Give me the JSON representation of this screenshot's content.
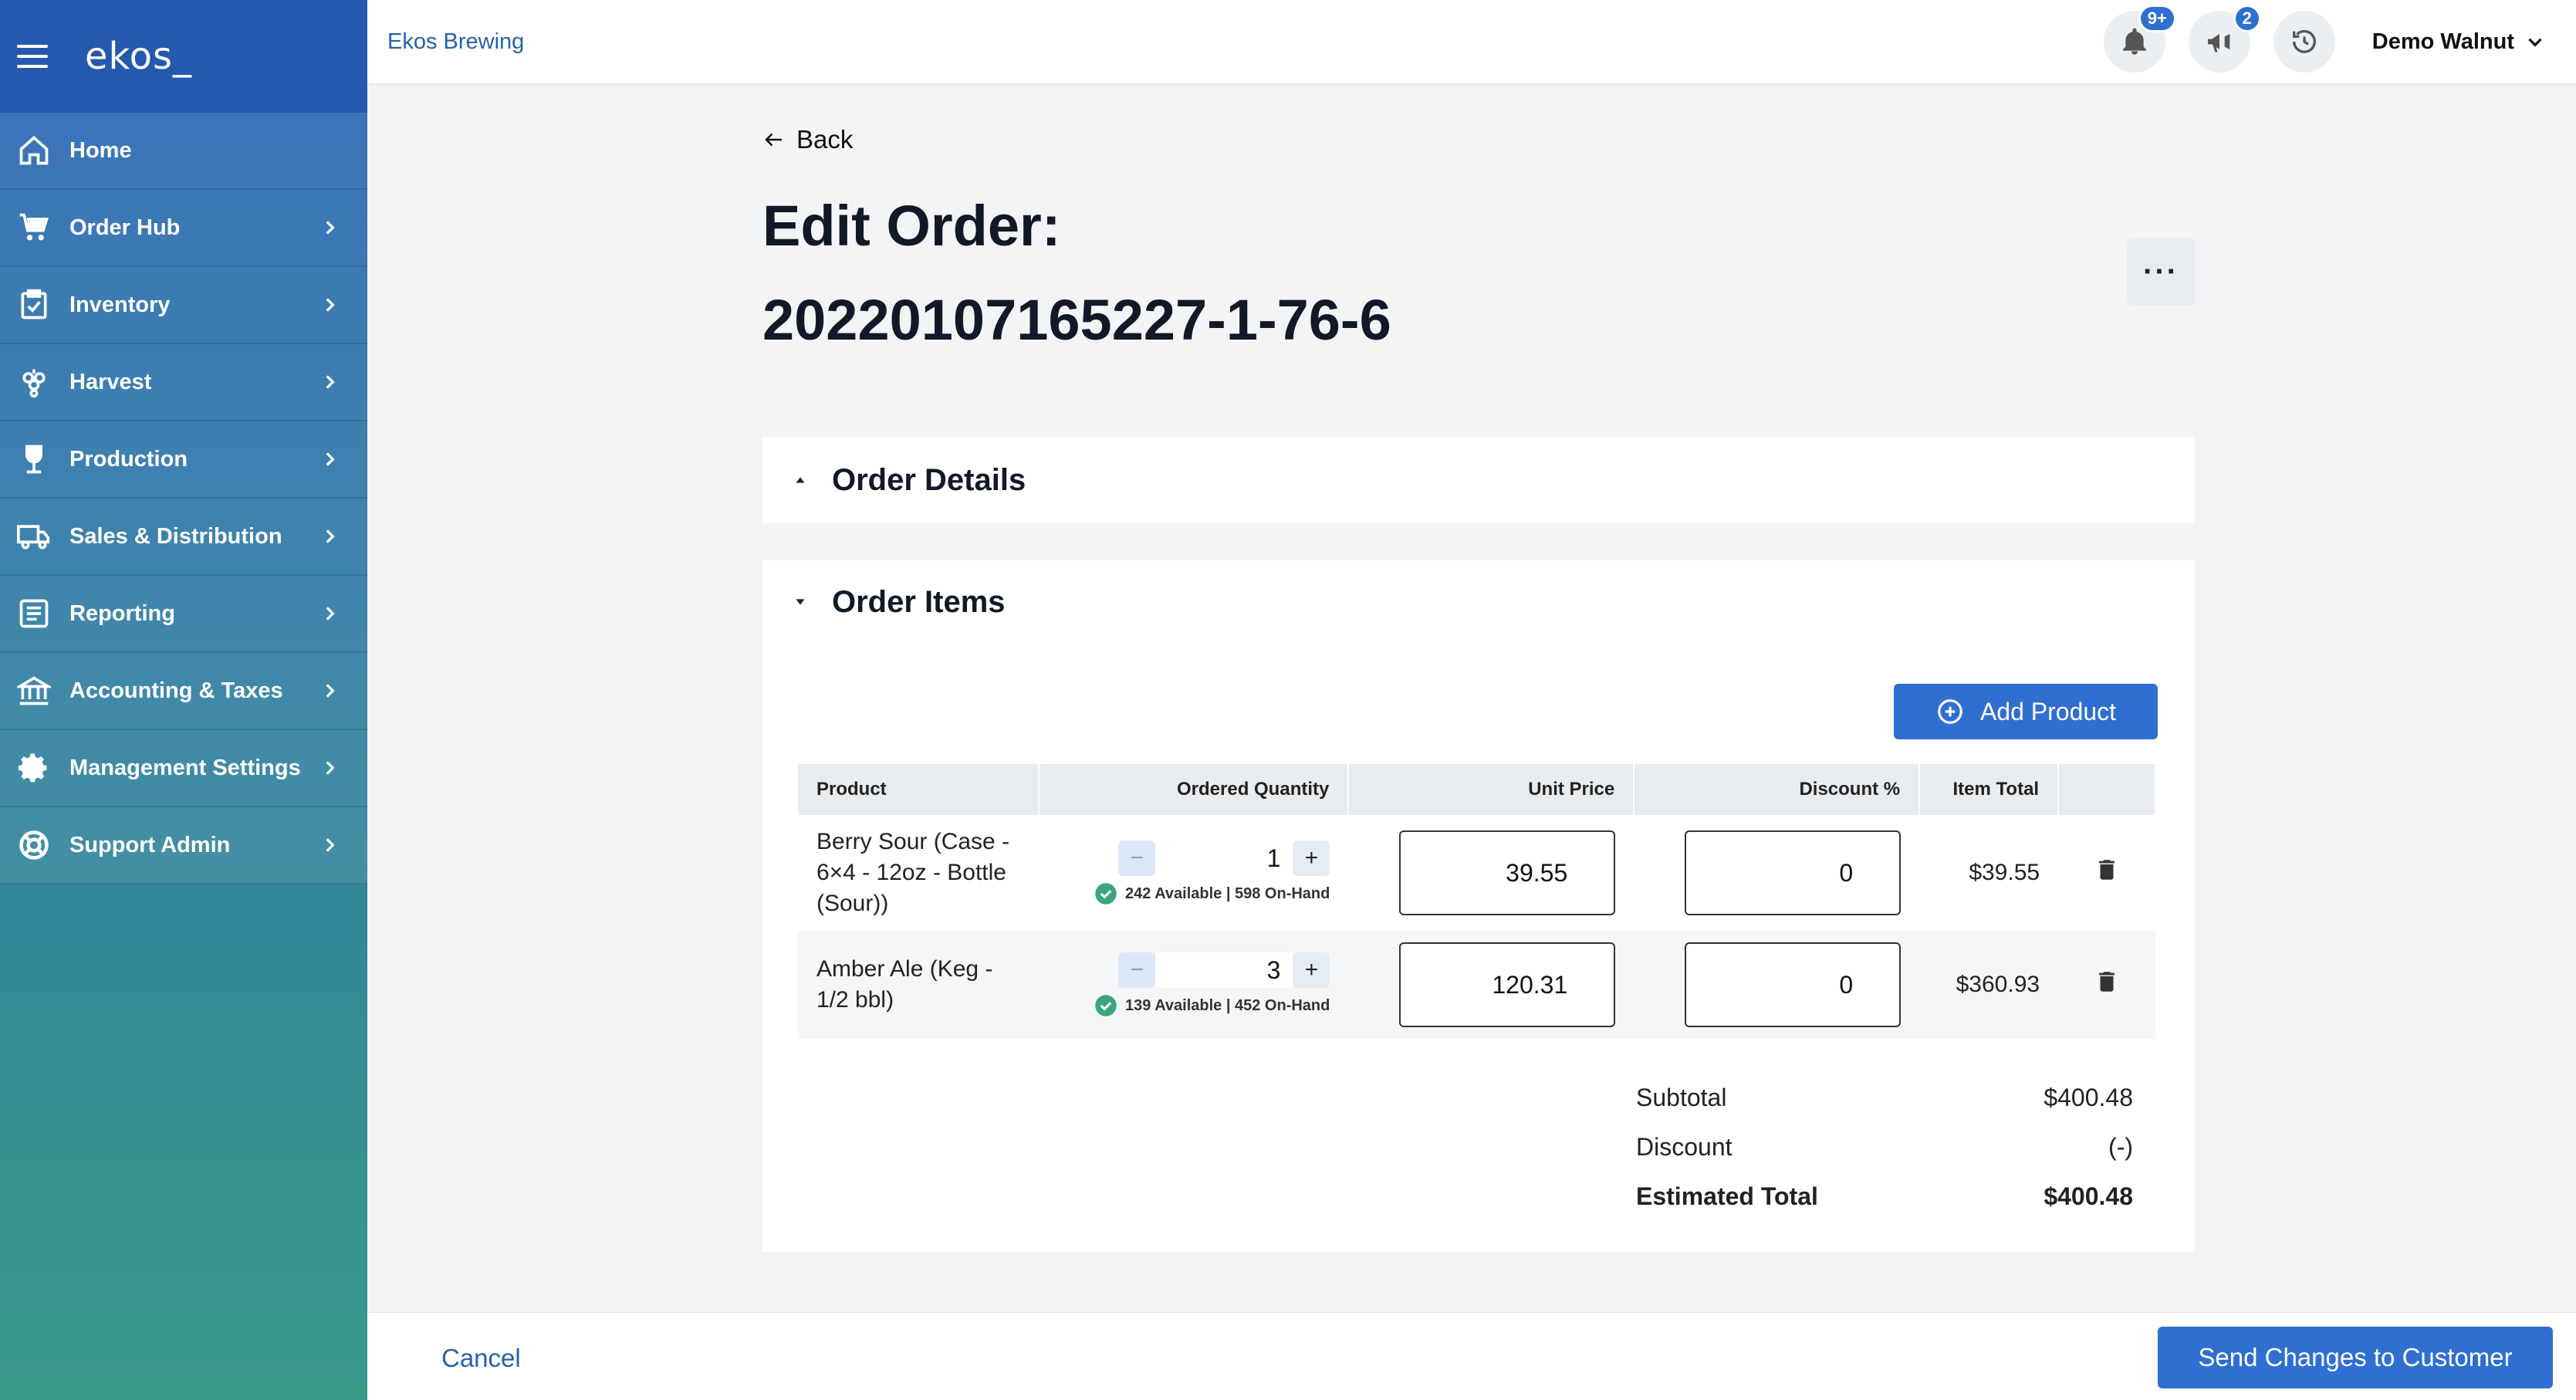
{
  "app": {
    "logo": "ekos_",
    "brand": "Ekos Brewing"
  },
  "sidebar": {
    "items": [
      {
        "label": "Home",
        "icon": "home-icon"
      },
      {
        "label": "Order Hub",
        "icon": "cart-icon"
      },
      {
        "label": "Inventory",
        "icon": "clipboard-icon"
      },
      {
        "label": "Harvest",
        "icon": "grapes-icon"
      },
      {
        "label": "Production",
        "icon": "glass-icon"
      },
      {
        "label": "Sales & Distribution",
        "icon": "truck-icon"
      },
      {
        "label": "Reporting",
        "icon": "report-icon"
      },
      {
        "label": "Accounting & Taxes",
        "icon": "bank-icon"
      },
      {
        "label": "Management Settings",
        "icon": "gear-icon"
      },
      {
        "label": "Support Admin",
        "icon": "lifebuoy-icon"
      }
    ]
  },
  "header": {
    "notifications_badge": "9+",
    "announcements_badge": "2",
    "user_name": "Demo Walnut"
  },
  "page": {
    "back_label": "Back",
    "title_line1": "Edit Order:",
    "title_line2": "20220107165227-1-76-6",
    "more_label": "···"
  },
  "order_details": {
    "title": "Order Details"
  },
  "order_items": {
    "title": "Order Items",
    "add_product_label": "Add Product",
    "columns": [
      "Product",
      "Ordered Quantity",
      "Unit Price",
      "Discount %",
      "Item Total"
    ],
    "rows": [
      {
        "product": "Berry Sour (Case - 6×4 - 12oz - Bottle (Sour))",
        "quantity": "1",
        "availability": "242 Available | 598 On-Hand",
        "unit_price": "39.55",
        "discount": "0",
        "item_total": "$39.55"
      },
      {
        "product": "Amber Ale (Keg - 1/2 bbl)",
        "quantity": "3",
        "availability": "139 Available | 452 On-Hand",
        "unit_price": "120.31",
        "discount": "0",
        "item_total": "$360.93"
      }
    ],
    "totals": {
      "subtotal_label": "Subtotal",
      "subtotal_value": "$400.48",
      "discount_label": "Discount",
      "discount_value": "(-)",
      "estimated_label": "Estimated Total",
      "estimated_value": "$400.48"
    }
  },
  "footer": {
    "cancel_label": "Cancel",
    "send_label": "Send Changes to Customer"
  },
  "colors": {
    "primary": "#2f6fd1",
    "link": "#2563a8",
    "success": "#3aa67a"
  }
}
